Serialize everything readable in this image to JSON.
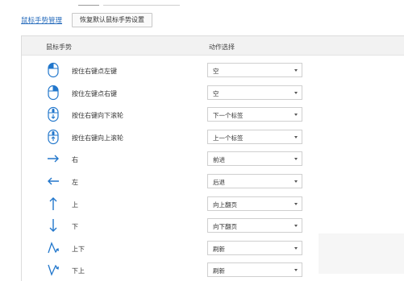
{
  "page": {
    "manage_link": "鼠标手势管理",
    "reset_button": "恢复默认鼠标手势设置"
  },
  "table": {
    "col_gesture": "鼠标手势",
    "col_action": "动作选择"
  },
  "rows": [
    {
      "icon": "mouse-right-click-icon",
      "label": "按住右键点左键",
      "action": "空"
    },
    {
      "icon": "mouse-left-click-icon",
      "label": "按住左键点右键",
      "action": "空"
    },
    {
      "icon": "mouse-scroll-down-icon",
      "label": "按住右键向下滚轮",
      "action": "下一个标签"
    },
    {
      "icon": "mouse-scroll-up-icon",
      "label": "按住右键向上滚轮",
      "action": "上一个标签"
    },
    {
      "icon": "arrow-right-icon",
      "label": "右",
      "action": "前进"
    },
    {
      "icon": "arrow-left-icon",
      "label": "左",
      "action": "后退"
    },
    {
      "icon": "arrow-up-icon",
      "label": "上",
      "action": "向上翻页"
    },
    {
      "icon": "arrow-down-icon",
      "label": "下",
      "action": "向下翻页"
    },
    {
      "icon": "arrow-up-down-icon",
      "label": "上下",
      "action": "刷新"
    },
    {
      "icon": "arrow-down-up-icon",
      "label": "下上",
      "action": "刷新"
    }
  ],
  "colors": {
    "icon": "#2277cc",
    "link": "#2a6ebd",
    "header_bg": "#f2f2f2"
  }
}
